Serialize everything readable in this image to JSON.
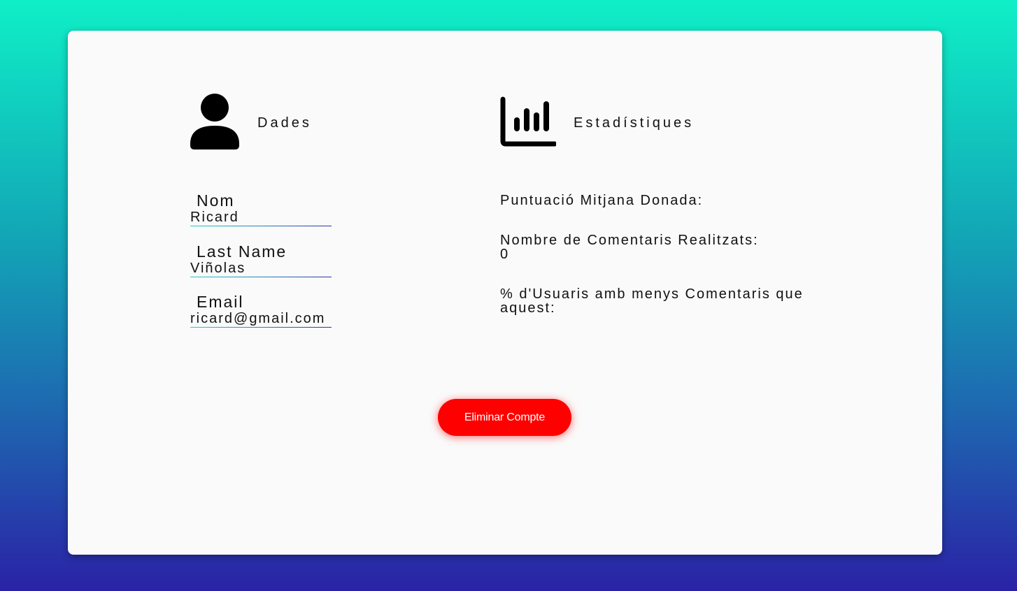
{
  "profile": {
    "section_title": "Dades",
    "section_icon": "user-icon",
    "fields": {
      "nom": {
        "label": "Nom",
        "value": "Ricard"
      },
      "last_name": {
        "label": "Last Name",
        "value": "Viñolas"
      },
      "email": {
        "label": "Email",
        "value": "ricard@gmail.com"
      }
    }
  },
  "stats": {
    "section_title": "Estadístiques",
    "section_icon": "bar-chart-icon",
    "items": [
      {
        "label": "Puntuació Mitjana Donada:",
        "value": ""
      },
      {
        "label": "Nombre de Comentaris Realitzats:",
        "value": "0"
      },
      {
        "label": "% d'Usuaris amb menys Comentaris que aquest:",
        "value": ""
      }
    ]
  },
  "actions": {
    "delete_label": "Eliminar Compte",
    "delete_color": "#ff0000"
  },
  "colors": {
    "background_top": "#0fefc7",
    "background_bottom": "#2a22a6",
    "card": "#fafafa"
  }
}
